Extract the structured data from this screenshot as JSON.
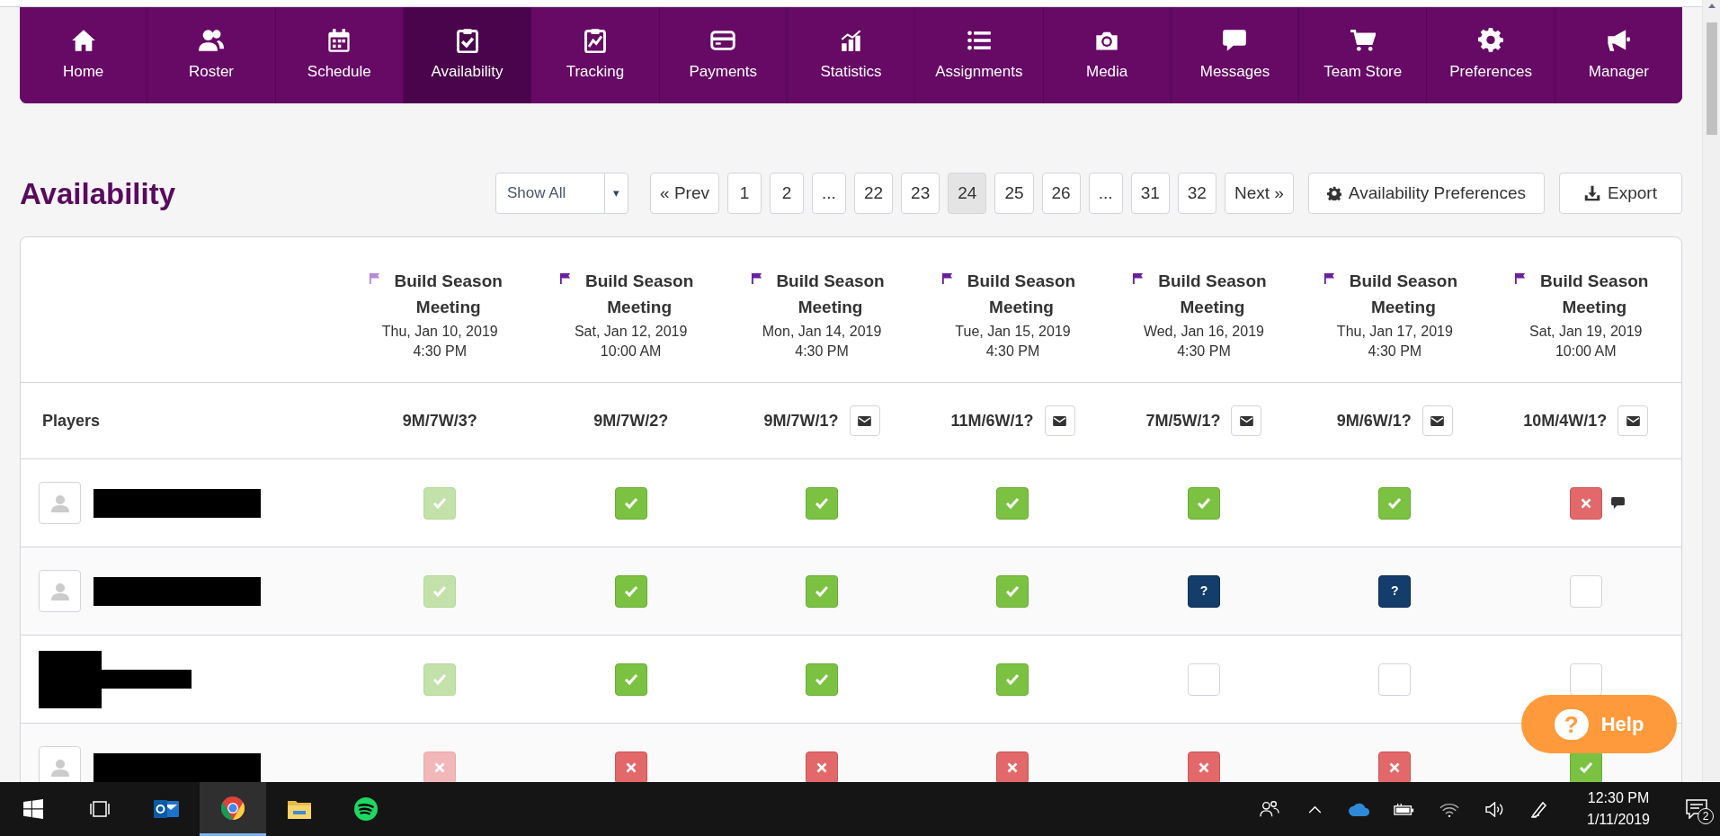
{
  "nav": [
    {
      "label": "Home",
      "selected": false
    },
    {
      "label": "Roster",
      "selected": false
    },
    {
      "label": "Schedule",
      "selected": false
    },
    {
      "label": "Availability",
      "selected": true
    },
    {
      "label": "Tracking",
      "selected": false
    },
    {
      "label": "Payments",
      "selected": false
    },
    {
      "label": "Statistics",
      "selected": false
    },
    {
      "label": "Assignments",
      "selected": false
    },
    {
      "label": "Media",
      "selected": false
    },
    {
      "label": "Messages",
      "selected": false
    },
    {
      "label": "Team Store",
      "selected": false
    },
    {
      "label": "Preferences",
      "selected": false
    },
    {
      "label": "Manager",
      "selected": false
    }
  ],
  "page_title": "Availability",
  "filter": {
    "value": "Show All",
    "caret": "▾"
  },
  "pagination": [
    {
      "label": "« Prev",
      "selected": false
    },
    {
      "label": "1",
      "selected": false
    },
    {
      "label": "2",
      "selected": false
    },
    {
      "label": "...",
      "selected": false
    },
    {
      "label": "22",
      "selected": false
    },
    {
      "label": "23",
      "selected": false
    },
    {
      "label": "24",
      "selected": true
    },
    {
      "label": "25",
      "selected": false
    },
    {
      "label": "26",
      "selected": false
    },
    {
      "label": "...",
      "selected": false
    },
    {
      "label": "31",
      "selected": false
    },
    {
      "label": "32",
      "selected": false
    },
    {
      "label": "Next »",
      "selected": false
    }
  ],
  "buttons": {
    "preferences": "Availability Preferences",
    "export": "Export"
  },
  "events": [
    {
      "title": "Build Season Meeting",
      "date": "Thu, Jan 10, 2019",
      "time": "4:30 PM",
      "past": true,
      "count": "9M/7W/3?",
      "email_button": false
    },
    {
      "title": "Build Season Meeting",
      "date": "Sat, Jan 12, 2019",
      "time": "10:00 AM",
      "past": false,
      "count": "9M/7W/2?",
      "email_button": false
    },
    {
      "title": "Build Season Meeting",
      "date": "Mon, Jan 14, 2019",
      "time": "4:30 PM",
      "past": false,
      "count": "9M/7W/1?",
      "email_button": true
    },
    {
      "title": "Build Season Meeting",
      "date": "Tue, Jan 15, 2019",
      "time": "4:30 PM",
      "past": false,
      "count": "11M/6W/1?",
      "email_button": true
    },
    {
      "title": "Build Season Meeting",
      "date": "Wed, Jan 16, 2019",
      "time": "4:30 PM",
      "past": false,
      "count": "7M/5W/1?",
      "email_button": true
    },
    {
      "title": "Build Season Meeting",
      "date": "Thu, Jan 17, 2019",
      "time": "4:30 PM",
      "past": false,
      "count": "9M/6W/1?",
      "email_button": true
    },
    {
      "title": "Build Season Meeting",
      "date": "Sat, Jan 19, 2019",
      "time": "10:00 AM",
      "past": false,
      "count": "10M/4W/1?",
      "email_button": true
    }
  ],
  "players_label": "Players",
  "rows": [
    {
      "avatar": true,
      "cells": [
        {
          "kind": "yes"
        },
        {
          "kind": "yes"
        },
        {
          "kind": "yes"
        },
        {
          "kind": "yes"
        },
        {
          "kind": "yes"
        },
        {
          "kind": "yes"
        },
        {
          "kind": "no",
          "comment": true
        }
      ]
    },
    {
      "avatar": true,
      "cells": [
        {
          "kind": "yes"
        },
        {
          "kind": "yes"
        },
        {
          "kind": "yes"
        },
        {
          "kind": "yes"
        },
        {
          "kind": "maybe",
          "symbol": "?"
        },
        {
          "kind": "maybe",
          "symbol": "?"
        },
        {
          "kind": "empty"
        }
      ]
    },
    {
      "avatar": false,
      "cells": [
        {
          "kind": "yes"
        },
        {
          "kind": "yes"
        },
        {
          "kind": "yes"
        },
        {
          "kind": "yes"
        },
        {
          "kind": "empty"
        },
        {
          "kind": "empty"
        },
        {
          "kind": "empty"
        }
      ]
    },
    {
      "avatar": true,
      "cells": [
        {
          "kind": "no"
        },
        {
          "kind": "no"
        },
        {
          "kind": "no"
        },
        {
          "kind": "no"
        },
        {
          "kind": "no"
        },
        {
          "kind": "no"
        },
        {
          "kind": "yes"
        }
      ]
    }
  ],
  "help": {
    "icon": "?",
    "label": "Help"
  },
  "taskbar": {
    "apps": [
      {
        "selected": false
      },
      {
        "selected": true
      },
      {
        "selected": false
      },
      {
        "selected": false
      }
    ],
    "time": "12:30 PM",
    "date": "1/11/2019",
    "notifications": "2"
  }
}
